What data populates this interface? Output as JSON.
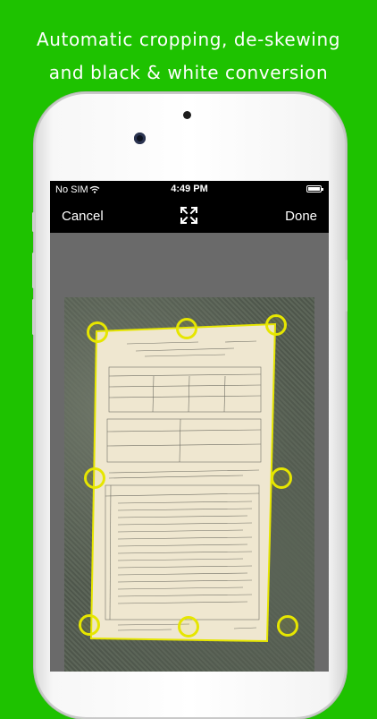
{
  "promo": {
    "line1": "Automatic cropping, de-skewing",
    "line2": "and black & white conversion"
  },
  "status_bar": {
    "carrier": "No SIM",
    "time": "4:49 PM",
    "wifi_icon": "wifi-icon",
    "battery_icon": "battery-icon"
  },
  "nav_bar": {
    "cancel_label": "Cancel",
    "done_label": "Done",
    "center_icon": "expand-arrows-icon"
  },
  "crop": {
    "handle_color": "#e6e600",
    "handles": [
      "top-left",
      "top-middle",
      "top-right",
      "middle-left",
      "middle-right",
      "bottom-left",
      "bottom-middle",
      "bottom-right"
    ]
  },
  "colors": {
    "background": "#1ec200",
    "toolbar": "#000000",
    "crop_frame": "#e6e600"
  }
}
